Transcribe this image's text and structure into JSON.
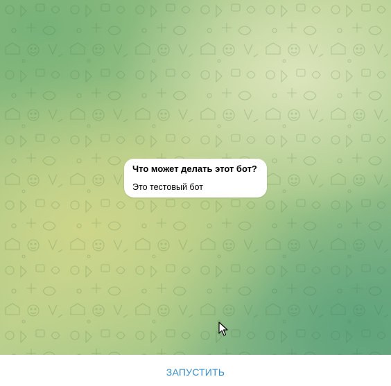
{
  "bot_info": {
    "title": "Что может делать этот бот?",
    "description": "Это тестовый бот"
  },
  "bottom_bar": {
    "start_label": "ЗАПУСТИТЬ"
  },
  "colors": {
    "accent": "#3a8ec7",
    "bubble_background": "#ffffff",
    "bar_background": "#ffffff"
  },
  "icons": {
    "cursor": "mouse-pointer-icon"
  }
}
